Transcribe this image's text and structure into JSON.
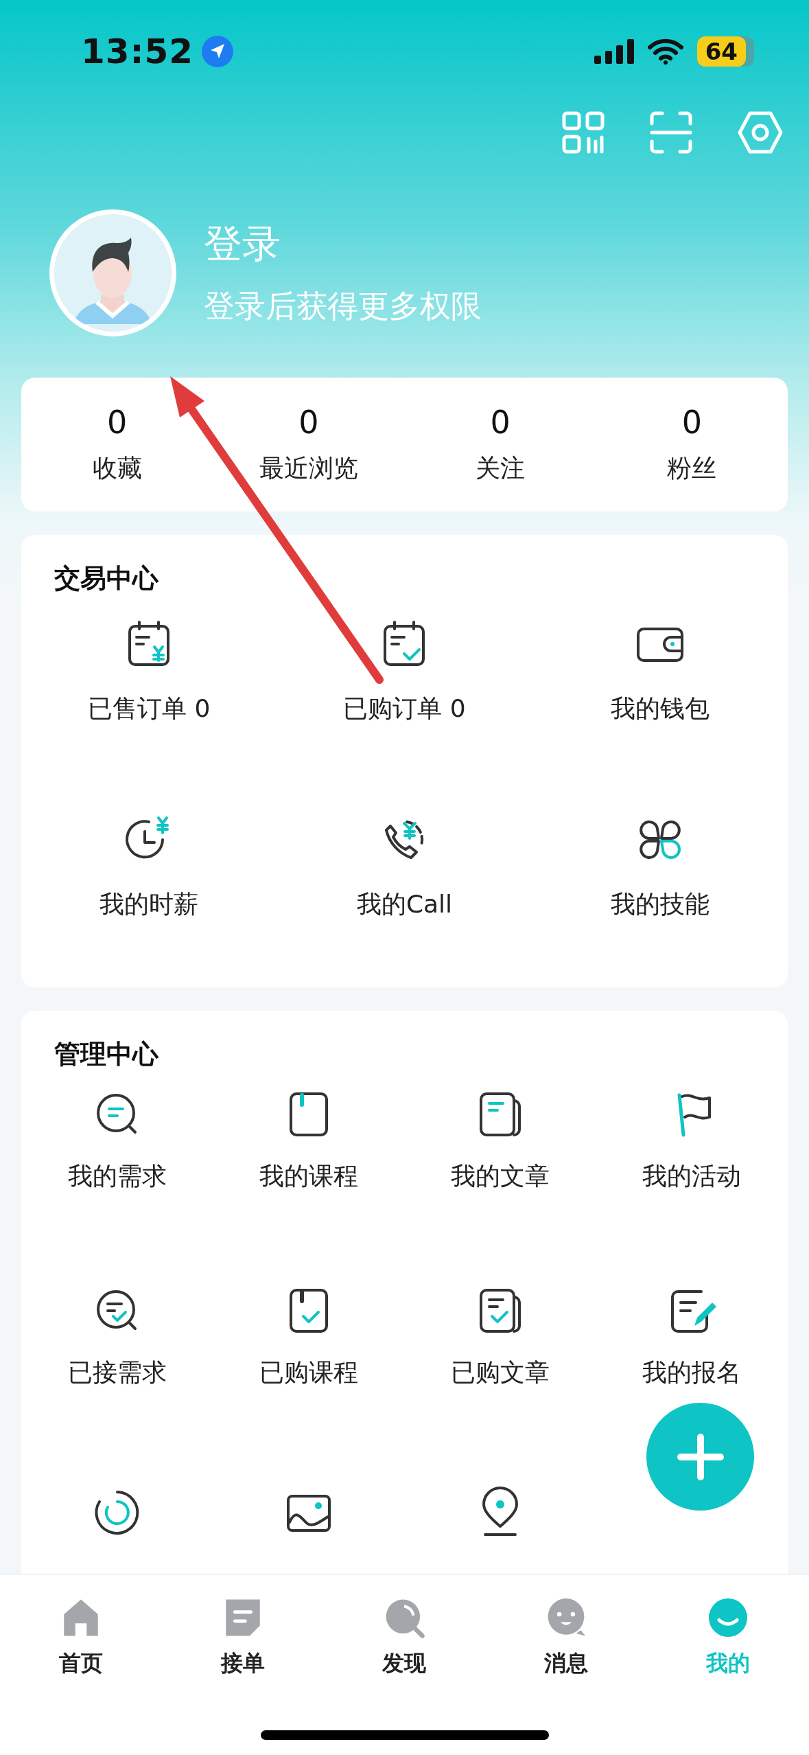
{
  "status_bar": {
    "time": "13:52",
    "battery": "64"
  },
  "profile": {
    "title": "登录",
    "subtitle": "登录后获得更多权限"
  },
  "stats": [
    {
      "value": "0",
      "label": "收藏"
    },
    {
      "value": "0",
      "label": "最近浏览"
    },
    {
      "value": "0",
      "label": "关注"
    },
    {
      "value": "0",
      "label": "粉丝"
    }
  ],
  "trade_center": {
    "title": "交易中心",
    "items": [
      {
        "label": "已售订单 0"
      },
      {
        "label": "已购订单 0"
      },
      {
        "label": "我的钱包"
      },
      {
        "label": "我的时薪"
      },
      {
        "label": "我的Call"
      },
      {
        "label": "我的技能"
      }
    ]
  },
  "manage_center": {
    "title": "管理中心",
    "items": [
      {
        "label": "我的需求"
      },
      {
        "label": "我的课程"
      },
      {
        "label": "我的文章"
      },
      {
        "label": "我的活动"
      },
      {
        "label": "已接需求"
      },
      {
        "label": "已购课程"
      },
      {
        "label": "已购文章"
      },
      {
        "label": "我的报名"
      },
      {
        "kind": "icon_only"
      },
      {
        "kind": "icon_only"
      },
      {
        "kind": "icon_only"
      }
    ]
  },
  "tabs": [
    {
      "label": "首页",
      "selected": false
    },
    {
      "label": "接单",
      "selected": false
    },
    {
      "label": "发现",
      "selected": false
    },
    {
      "label": "消息",
      "selected": false
    },
    {
      "label": "我的",
      "selected": true
    }
  ]
}
